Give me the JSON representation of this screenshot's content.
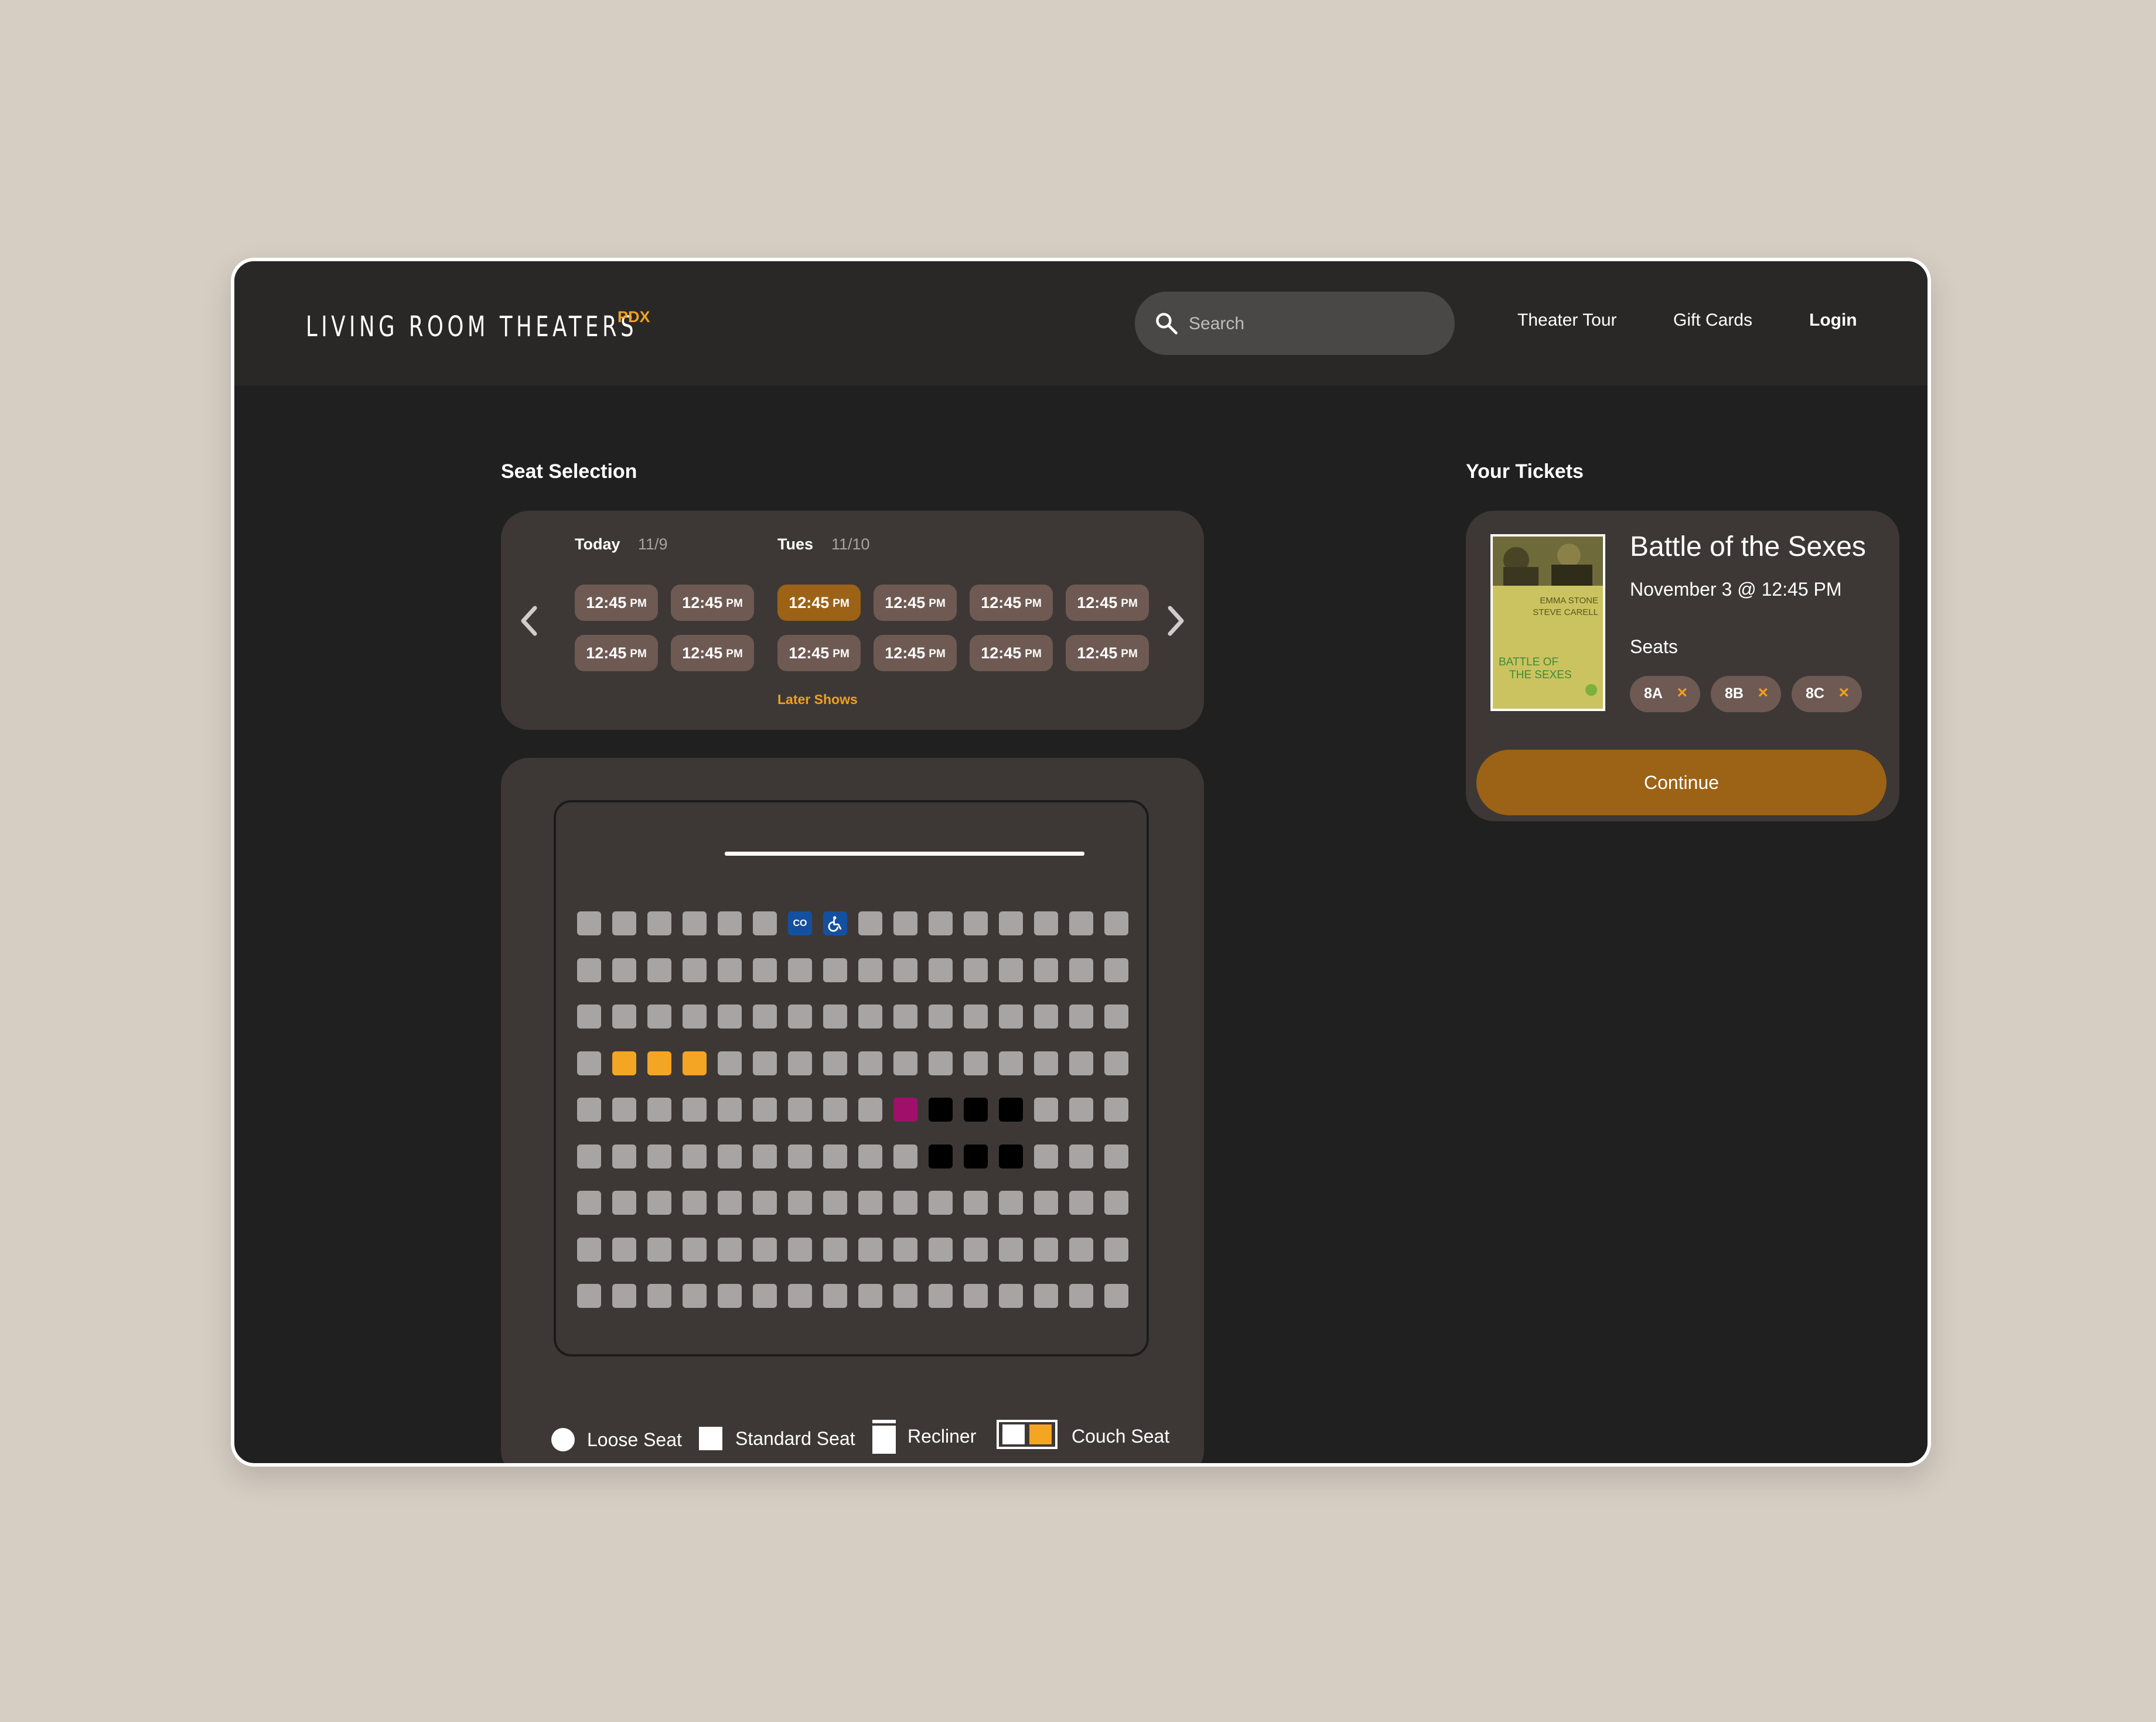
{
  "header": {
    "logo": "LIVING ROOM THEATERS",
    "logo_tag": "PDX",
    "search_placeholder": "Search",
    "nav": [
      "Theater Tour",
      "Gift Cards",
      "Login"
    ]
  },
  "seat_selection": {
    "title": "Seat Selection",
    "days": [
      {
        "label": "Today",
        "date": "11/9"
      },
      {
        "label": "Tues",
        "date": "11/10"
      }
    ],
    "time_main": "12:45",
    "time_suffix": "PM",
    "selected_time_index": 2,
    "later_shows": "Later Shows"
  },
  "seat_map": {
    "rows": 9,
    "cols": 16,
    "companion_label": "CO",
    "companion_seat": [
      0,
      6
    ],
    "wheelchair_seat": [
      0,
      7
    ],
    "selected_seats": [
      [
        3,
        1
      ],
      [
        3,
        2
      ],
      [
        3,
        3
      ]
    ],
    "magenta_seats": [
      [
        4,
        9
      ]
    ],
    "black_seats": [
      [
        4,
        10
      ],
      [
        4,
        11
      ],
      [
        4,
        12
      ],
      [
        5,
        10
      ],
      [
        5,
        11
      ],
      [
        5,
        12
      ]
    ],
    "legend": [
      "Loose Seat",
      "Standard Seat",
      "Recliner",
      "Couch Seat"
    ]
  },
  "tickets": {
    "title": "Your Tickets",
    "movie_title": "Battle of the Sexes",
    "when": "November 3 @ 12:45 PM",
    "seats_label": "Seats",
    "seats": [
      "8A",
      "8B",
      "8C"
    ],
    "continue_label": "Continue",
    "poster": {
      "actor_1": "EMMA STONE",
      "actor_2": "STEVE CARELL",
      "title_line_1": "BATTLE OF",
      "title_line_2": "THE SEXES"
    }
  },
  "colors": {
    "accent": "#f0a020",
    "active_time": "#9c6216",
    "selected_seat": "#f5a524",
    "panel": "#3d3836"
  }
}
